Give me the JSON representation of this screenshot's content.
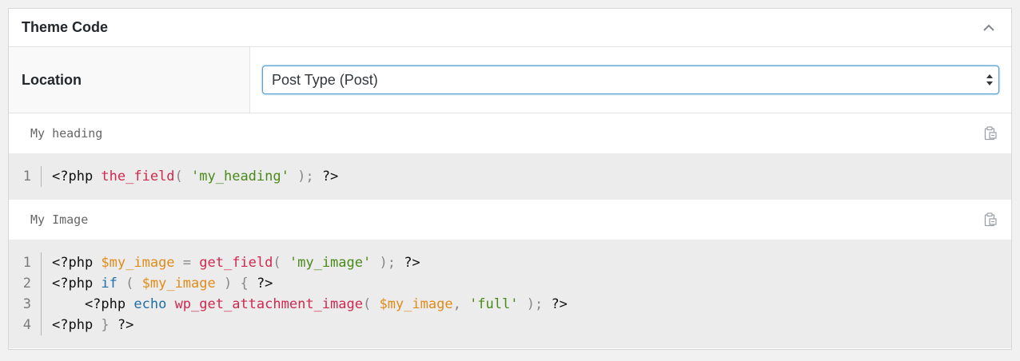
{
  "panel": {
    "title": "Theme Code",
    "collapse_icon": "chevron-up-icon"
  },
  "location": {
    "label": "Location",
    "selected": "Post Type (Post)"
  },
  "sections": [
    {
      "title": "My heading",
      "copy_icon": "clipboard-icon",
      "lines": [
        {
          "num": "1"
        }
      ]
    },
    {
      "title": "My Image",
      "copy_icon": "clipboard-icon",
      "lines": [
        {
          "num": "1"
        },
        {
          "num": "2"
        },
        {
          "num": "3"
        },
        {
          "num": "4"
        }
      ]
    }
  ],
  "tokens": {
    "s1l1": [
      "<?php ",
      "the_field",
      "( ",
      "'my_heading'",
      " ); ",
      "?>"
    ],
    "s2l1": [
      "<?php ",
      "$my_image",
      " = ",
      "get_field",
      "( ",
      "'my_image'",
      " ); ",
      "?>"
    ],
    "s2l2": [
      "<?php ",
      "if",
      " ( ",
      "$my_image",
      " ) { ",
      "?>"
    ],
    "s2l3": [
      "    <?php ",
      "echo",
      " ",
      "wp_get_attachment_image",
      "( ",
      "$my_image",
      ", ",
      "'full'",
      " ); ",
      "?>"
    ],
    "s2l4": [
      "<?php ",
      "} ",
      "?>"
    ]
  },
  "colors": {
    "keyword": "#1f6fa8",
    "function": "#d0294f",
    "string": "#4a8a1a",
    "variable": "#e08c1a",
    "focus_border": "#5b9dd9"
  }
}
